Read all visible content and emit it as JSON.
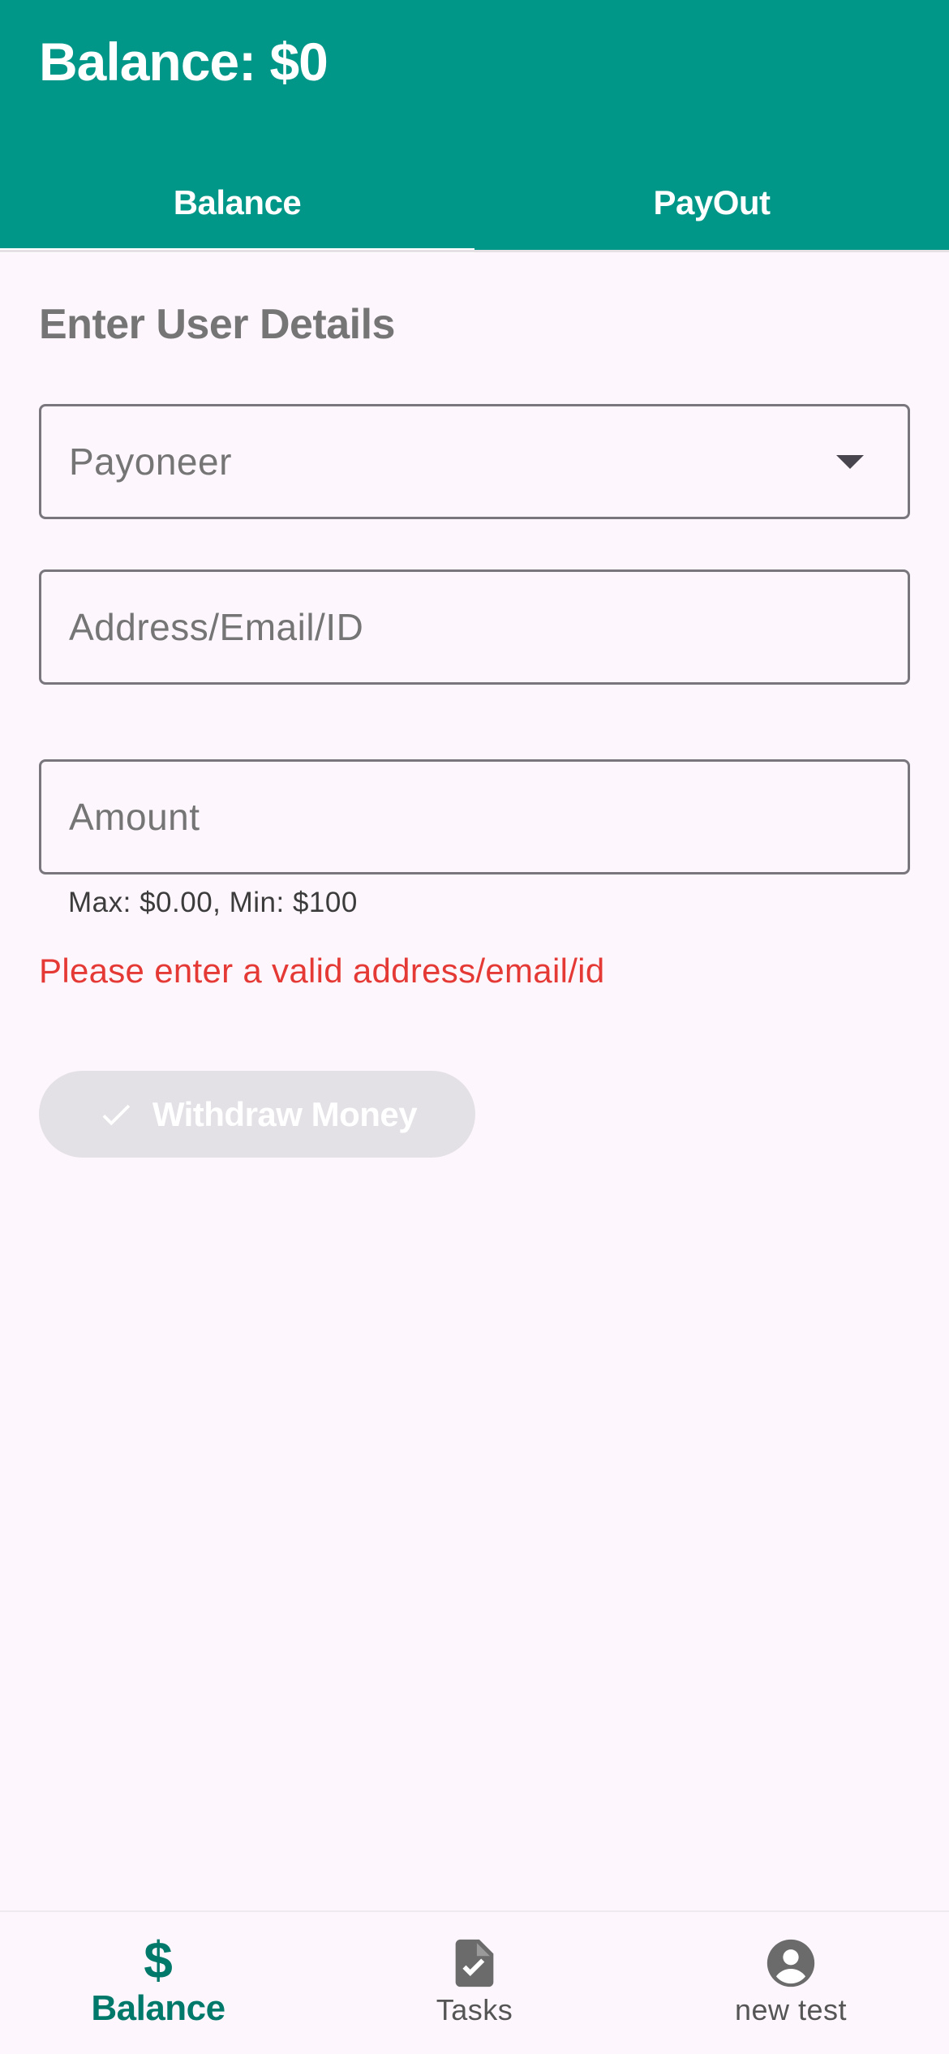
{
  "appbar": {
    "title": "Balance: $0"
  },
  "tabs": [
    {
      "label": "Balance",
      "selected": true
    },
    {
      "label": "PayOut",
      "selected": false
    }
  ],
  "form": {
    "heading": "Enter User Details",
    "method_selected": "Payoneer",
    "address_placeholder": "Address/Email/ID",
    "amount_placeholder": "Amount",
    "amount_helper": "Max: $0.00, Min: $100",
    "error_message": "Please enter a valid address/email/id",
    "withdraw_label": "Withdraw Money"
  },
  "bottom_nav": {
    "items": [
      {
        "label": "Balance",
        "icon": "dollar-icon",
        "active": true
      },
      {
        "label": "Tasks",
        "icon": "task-document-icon",
        "active": false
      },
      {
        "label": "new test",
        "icon": "account-circle-icon",
        "active": false
      }
    ]
  },
  "colors": {
    "primary": "#009688",
    "active_nav": "#00796B",
    "error": "#e53935",
    "background": "#FDF7FD",
    "disabled_button": "#E4E1E6"
  }
}
